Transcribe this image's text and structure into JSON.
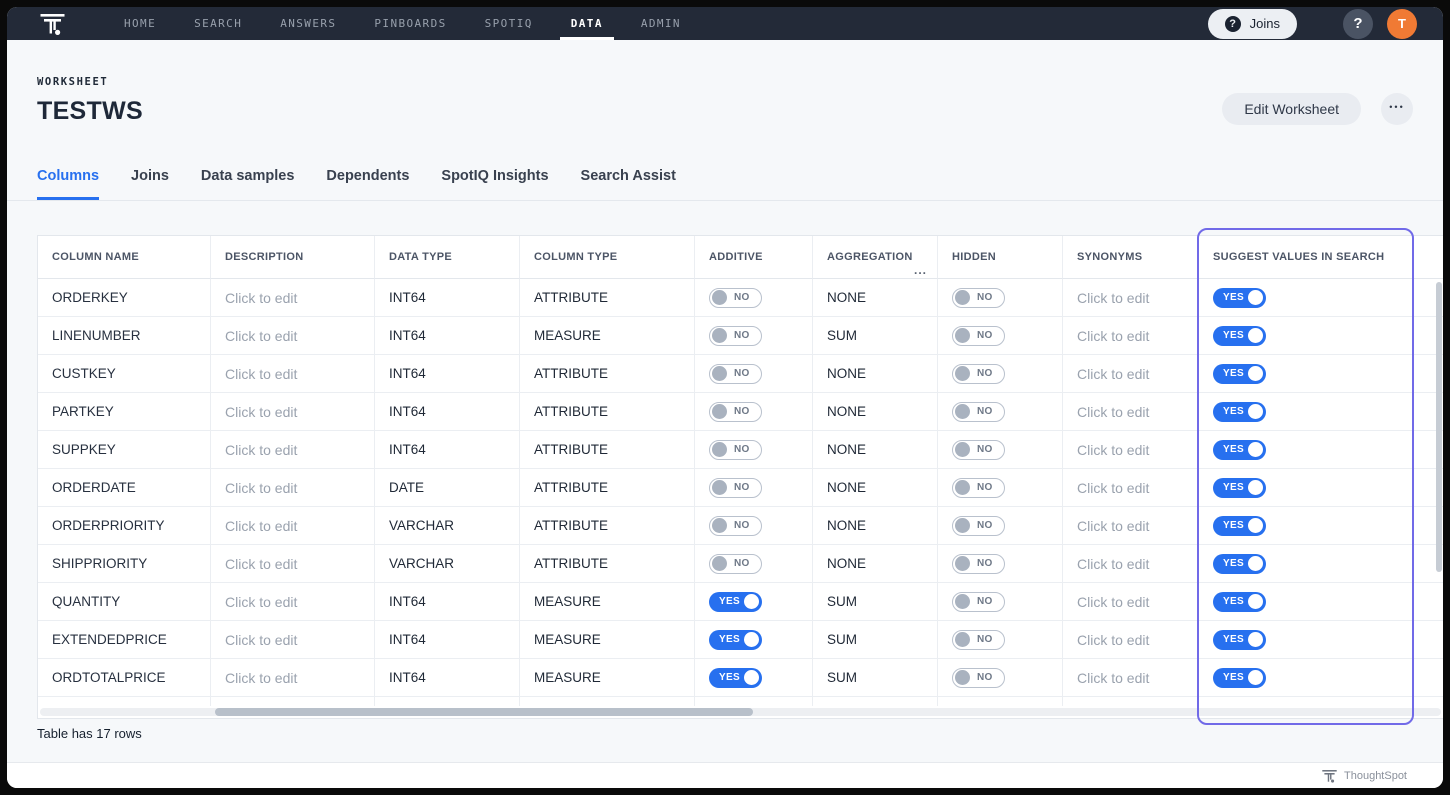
{
  "colors": {
    "accent_blue": "#2770EF",
    "highlight_purple": "#716AE8",
    "nav_background": "#232A38",
    "avatar_orange": "#F07A34",
    "page_background": "#F6F8FA"
  },
  "nav": {
    "items": [
      {
        "label": "HOME",
        "active": false
      },
      {
        "label": "SEARCH",
        "active": false
      },
      {
        "label": "ANSWERS",
        "active": false
      },
      {
        "label": "PINBOARDS",
        "active": false
      },
      {
        "label": "SPOTIQ",
        "active": false
      },
      {
        "label": "DATA",
        "active": true
      },
      {
        "label": "ADMIN",
        "active": false
      }
    ],
    "joins_button": {
      "icon": "?",
      "label": "Joins"
    },
    "help_button": "?",
    "avatar_initial": "T"
  },
  "header": {
    "eyebrow": "WORKSHEET",
    "title": "TESTWS",
    "edit_button_label": "Edit Worksheet",
    "more_button_label": "•••"
  },
  "tabs": [
    {
      "label": "Columns",
      "active": true
    },
    {
      "label": "Joins",
      "active": false
    },
    {
      "label": "Data samples",
      "active": false
    },
    {
      "label": "Dependents",
      "active": false
    },
    {
      "label": "SpotIQ Insights",
      "active": false
    },
    {
      "label": "Search Assist",
      "active": false
    }
  ],
  "table": {
    "headers": [
      "COLUMN NAME",
      "DESCRIPTION",
      "DATA TYPE",
      "COLUMN TYPE",
      "ADDITIVE",
      "AGGREGATION",
      "HIDDEN",
      "SYNONYMS",
      "SUGGEST VALUES IN SEARCH"
    ],
    "aggregation_overflow": "...",
    "rows": [
      {
        "name": "ORDERKEY",
        "description": "Click to edit",
        "data_type": "INT64",
        "column_type": "ATTRIBUTE",
        "additive": "NO",
        "aggregation": "NONE",
        "hidden": "NO",
        "synonyms": "Click to edit",
        "suggest_values_in_search": "YES"
      },
      {
        "name": "LINENUMBER",
        "description": "Click to edit",
        "data_type": "INT64",
        "column_type": "MEASURE",
        "additive": "NO",
        "aggregation": "SUM",
        "hidden": "NO",
        "synonyms": "Click to edit",
        "suggest_values_in_search": "YES"
      },
      {
        "name": "CUSTKEY",
        "description": "Click to edit",
        "data_type": "INT64",
        "column_type": "ATTRIBUTE",
        "additive": "NO",
        "aggregation": "NONE",
        "hidden": "NO",
        "synonyms": "Click to edit",
        "suggest_values_in_search": "YES"
      },
      {
        "name": "PARTKEY",
        "description": "Click to edit",
        "data_type": "INT64",
        "column_type": "ATTRIBUTE",
        "additive": "NO",
        "aggregation": "NONE",
        "hidden": "NO",
        "synonyms": "Click to edit",
        "suggest_values_in_search": "YES"
      },
      {
        "name": "SUPPKEY",
        "description": "Click to edit",
        "data_type": "INT64",
        "column_type": "ATTRIBUTE",
        "additive": "NO",
        "aggregation": "NONE",
        "hidden": "NO",
        "synonyms": "Click to edit",
        "suggest_values_in_search": "YES"
      },
      {
        "name": "ORDERDATE",
        "description": "Click to edit",
        "data_type": "DATE",
        "column_type": "ATTRIBUTE",
        "additive": "NO",
        "aggregation": "NONE",
        "hidden": "NO",
        "synonyms": "Click to edit",
        "suggest_values_in_search": "YES"
      },
      {
        "name": "ORDERPRIORITY",
        "description": "Click to edit",
        "data_type": "VARCHAR",
        "column_type": "ATTRIBUTE",
        "additive": "NO",
        "aggregation": "NONE",
        "hidden": "NO",
        "synonyms": "Click to edit",
        "suggest_values_in_search": "YES"
      },
      {
        "name": "SHIPPRIORITY",
        "description": "Click to edit",
        "data_type": "VARCHAR",
        "column_type": "ATTRIBUTE",
        "additive": "NO",
        "aggregation": "NONE",
        "hidden": "NO",
        "synonyms": "Click to edit",
        "suggest_values_in_search": "YES"
      },
      {
        "name": "QUANTITY",
        "description": "Click to edit",
        "data_type": "INT64",
        "column_type": "MEASURE",
        "additive": "YES",
        "aggregation": "SUM",
        "hidden": "NO",
        "synonyms": "Click to edit",
        "suggest_values_in_search": "YES"
      },
      {
        "name": "EXTENDEDPRICE",
        "description": "Click to edit",
        "data_type": "INT64",
        "column_type": "MEASURE",
        "additive": "YES",
        "aggregation": "SUM",
        "hidden": "NO",
        "synonyms": "Click to edit",
        "suggest_values_in_search": "YES"
      },
      {
        "name": "ORDTOTALPRICE",
        "description": "Click to edit",
        "data_type": "INT64",
        "column_type": "MEASURE",
        "additive": "YES",
        "aggregation": "SUM",
        "hidden": "NO",
        "synonyms": "Click to edit",
        "suggest_values_in_search": "YES"
      }
    ],
    "row_count_note": "Table has 17 rows"
  },
  "footer": {
    "brand": "ThoughtSpot"
  }
}
